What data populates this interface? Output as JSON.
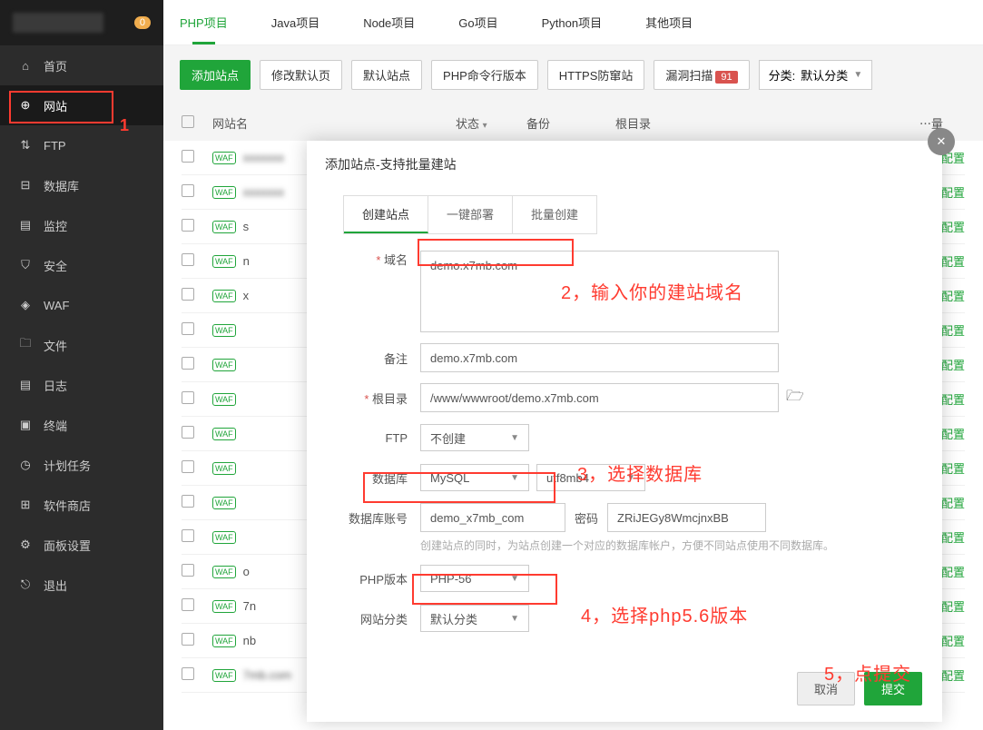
{
  "sidebar": {
    "badge": "0",
    "items": [
      {
        "label": "首页"
      },
      {
        "label": "网站"
      },
      {
        "label": "FTP"
      },
      {
        "label": "数据库"
      },
      {
        "label": "监控"
      },
      {
        "label": "安全"
      },
      {
        "label": "WAF"
      },
      {
        "label": "文件"
      },
      {
        "label": "日志"
      },
      {
        "label": "终端"
      },
      {
        "label": "计划任务"
      },
      {
        "label": "软件商店"
      },
      {
        "label": "面板设置"
      },
      {
        "label": "退出"
      }
    ],
    "annotation": "1"
  },
  "tabs": [
    "PHP项目",
    "Java项目",
    "Node项目",
    "Go项目",
    "Python项目",
    "其他项目"
  ],
  "toolbar": {
    "add": "添加站点",
    "defpage": "修改默认页",
    "defsite": "默认站点",
    "cli": "PHP命令行版本",
    "https": "HTTPS防窜站",
    "scan": "漏洞扫描",
    "scan_badge": "91",
    "cat_label": "分类:",
    "cat_value": "默认分类"
  },
  "thead": {
    "name": "网站名",
    "status": "状态",
    "backup": "备份",
    "root": "根目录",
    "end": "⋯量"
  },
  "row_end": "未配置",
  "modal": {
    "title": "添加站点-支持批量建站",
    "tabs": [
      "创建站点",
      "一键部署",
      "批量创建"
    ],
    "labels": {
      "domain": "域名",
      "remark": "备注",
      "root": "根目录",
      "ftp": "FTP",
      "db": "数据库",
      "dbuser": "数据库账号",
      "dbpass": "密码",
      "php": "PHP版本",
      "cat": "网站分类"
    },
    "values": {
      "domain": "demo.x7mb.com",
      "remark": "demo.x7mb.com",
      "root": "/www/wwwroot/demo.x7mb.com",
      "ftp": "不创建",
      "db": "MySQL",
      "charset": "utf8mb4",
      "dbuser": "demo_x7mb_com",
      "dbpass": "ZRiJEGy8WmcjnxBB",
      "php": "PHP-56",
      "cat": "默认分类"
    },
    "hint": "创建站点的同时，为站点创建一个对应的数据库帐户，方便不同站点使用不同数据库。",
    "cancel": "取消",
    "submit": "提交"
  },
  "annotations": {
    "a2": "2，输入你的建站域名",
    "a3": "3，选择数据库",
    "a4": "4，选择php5.6版本",
    "a5": "5，点提交"
  }
}
